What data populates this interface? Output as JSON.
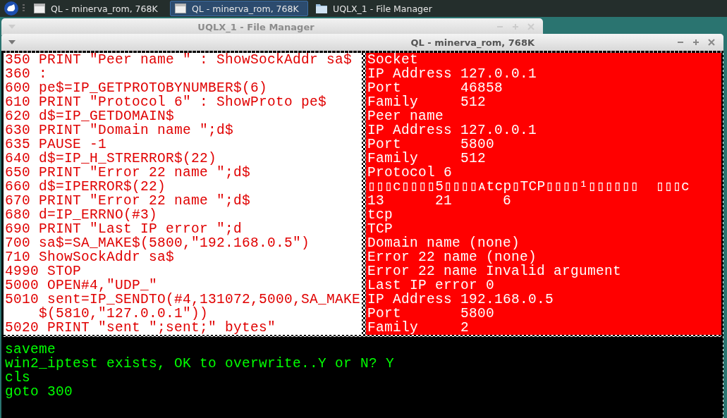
{
  "taskbar": {
    "tasks": [
      {
        "label": "QL - minerva_rom, 768K",
        "kind": "window",
        "selected": false
      },
      {
        "label": "QL - minerva_rom, 768K",
        "kind": "window",
        "selected": true
      },
      {
        "label": "UQLX_1 - File Manager",
        "kind": "folder",
        "selected": false
      }
    ]
  },
  "back_window": {
    "title": "UQLX_1 - File Manager"
  },
  "window": {
    "title": "QL - minerva_rom, 768K",
    "program_lines": [
      "350 PRINT \"Peer name \" : ShowSockAddr sa$",
      "360 :",
      "600 pe$=IP_GETPROTOBYNUMBER$(6)",
      "610 PRINT \"Protocol 6\" : ShowProto pe$",
      "620 d$=IP_GETDOMAIN$",
      "630 PRINT \"Domain name \";d$",
      "635 PAUSE -1",
      "640 d$=IP_H_STRERROR$(22)",
      "650 PRINT \"Error 22 name \";d$",
      "660 d$=IPERROR$(22)",
      "670 PRINT \"Error 22 name \";d$",
      "680 d=IP_ERRNO(#3)",
      "690 PRINT \"Last IP error \";d",
      "700 sa$=SA_MAKE$(5800,\"192.168.0.5\")",
      "710 ShowSockAddr sa$",
      "4990 STOP",
      "5000 OPEN#4,\"UDP_\"",
      "5010 sent=IP_SENDTO(#4,131072,5000,SA_MAKE",
      "    $(5810,\"127.0.0.1\"))",
      "5020 PRINT \"sent \";sent;\" bytes\""
    ],
    "output_lines": [
      "Socket",
      "IP Address 127.0.0.1",
      "Port       46858",
      "Family     512",
      "Peer name",
      "IP Address 127.0.0.1",
      "Port       5800",
      "Family     512",
      "Protocol 6",
      "▯▯▯c▯▯▯▯5▯▯▯▯ᴀtcp▯TCP▯▯▯▯¹▯▯▯▯▯▯  ▯▯▯c",
      "13      21      6",
      "tcp",
      "TCP",
      "Domain name (none)",
      "Error 22 name (none)",
      "Error 22 name Invalid argument",
      "Last IP error 0",
      "IP Address 192.168.0.5",
      "Port       5800",
      "Family     2"
    ],
    "command_lines": [
      "saveme",
      "win2_iptest exists, OK to overwrite..Y or N? Y",
      "cls",
      "goto 300"
    ]
  }
}
